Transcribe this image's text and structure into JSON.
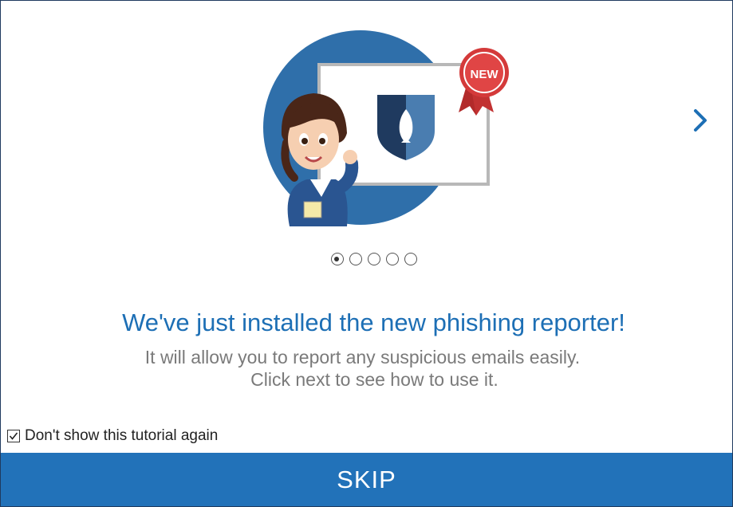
{
  "illustration": {
    "badge_text": "NEW",
    "colors": {
      "circle": "#2f6faa",
      "shield_dark": "#1f3a5f",
      "shield_light": "#4a7db0",
      "badge": "#d43a3a"
    }
  },
  "carousel": {
    "dots": [
      {
        "active": true
      },
      {
        "active": false
      },
      {
        "active": false
      },
      {
        "active": false
      },
      {
        "active": false
      }
    ],
    "next_icon": "chevron-right-icon"
  },
  "content": {
    "headline": "We've just installed the new phishing reporter!",
    "line1": "It will allow you to report any suspicious emails easily.",
    "line2": "Click next to see how to use it."
  },
  "footer": {
    "checkbox_label": "Don't show this tutorial again",
    "checkbox_checked": true,
    "skip_label": "SKIP"
  },
  "accent_color": "#2272b9"
}
